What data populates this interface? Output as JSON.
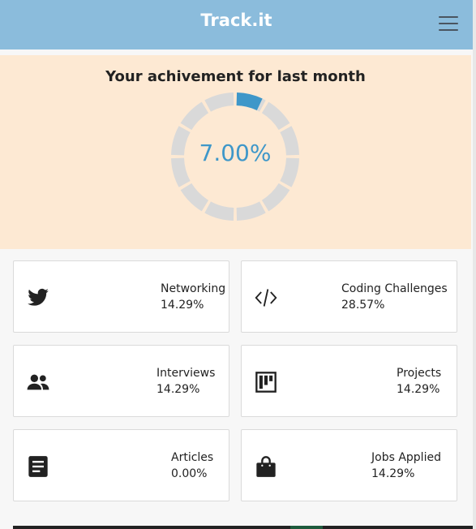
{
  "header": {
    "title": "Track.it",
    "menu_icon": "hamburger-menu-icon"
  },
  "hero": {
    "title": "Your achivement for last month",
    "progress_text": "7.00%",
    "progress_value": 7,
    "accent_color": "#3e97c9",
    "track_color": "#d9d9d9",
    "background_color": "#fde9d3"
  },
  "cards": [
    {
      "label": "Networking",
      "percent": "14.29%",
      "icon": "twitter-icon"
    },
    {
      "label": "Coding Challenges",
      "percent": "28.57%",
      "icon": "code-icon"
    },
    {
      "label": "Interviews",
      "percent": "14.29%",
      "icon": "users-icon"
    },
    {
      "label": "Projects",
      "percent": "14.29%",
      "icon": "kanban-board-icon"
    },
    {
      "label": "Articles",
      "percent": "0.00%",
      "icon": "newspaper-icon"
    },
    {
      "label": "Jobs Applied",
      "percent": "14.29%",
      "icon": "shopping-bag-icon"
    }
  ]
}
